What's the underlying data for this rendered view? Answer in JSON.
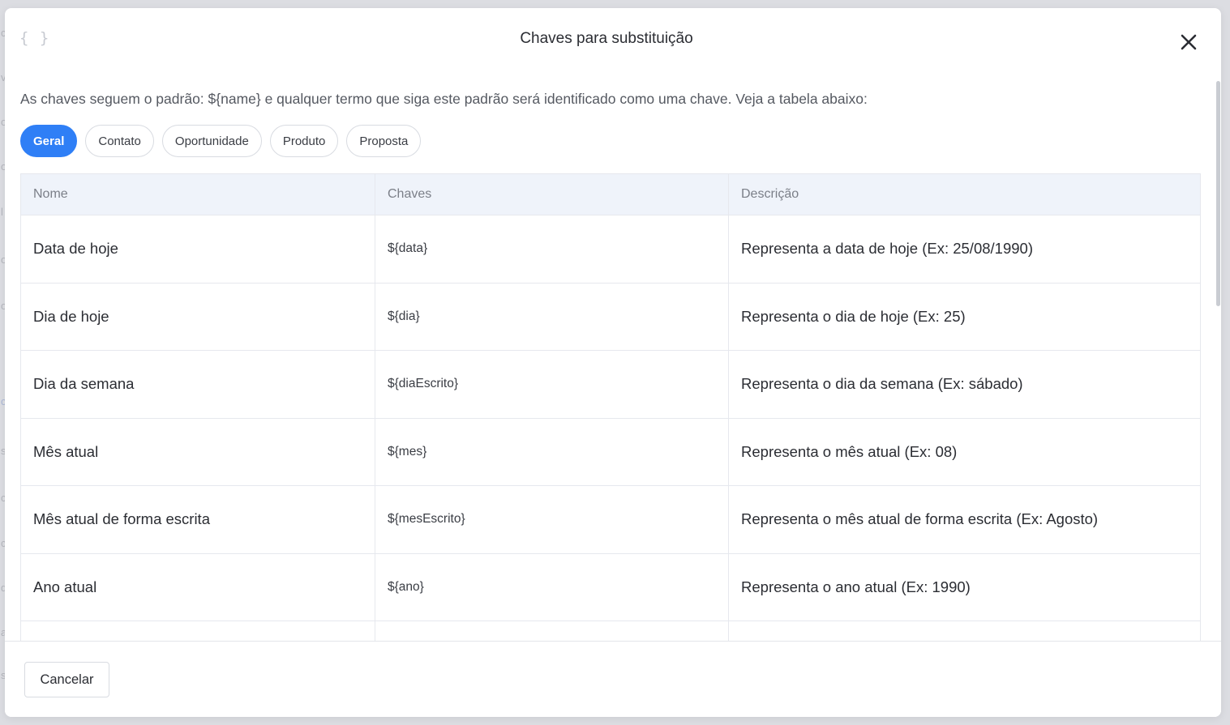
{
  "modal": {
    "title": "Chaves para substituição",
    "header_icon": "braces-icon",
    "close_icon": "close-icon"
  },
  "intro": "As chaves seguem o padrão: ${name} e qualquer termo que siga este padrão será identificado como uma chave. Veja a tabela abaixo:",
  "tabs": [
    {
      "label": "Geral",
      "active": true
    },
    {
      "label": "Contato",
      "active": false
    },
    {
      "label": "Oportunidade",
      "active": false
    },
    {
      "label": "Produto",
      "active": false
    },
    {
      "label": "Proposta",
      "active": false
    }
  ],
  "table": {
    "headers": [
      "Nome",
      "Chaves",
      "Descrição"
    ],
    "rows": [
      {
        "name": "Data de hoje",
        "key": "${data}",
        "description": "Representa a data de hoje (Ex: 25/08/1990)"
      },
      {
        "name": "Dia de hoje",
        "key": "${dia}",
        "description": "Representa o dia de hoje (Ex: 25)"
      },
      {
        "name": "Dia da semana",
        "key": "${diaEscrito}",
        "description": "Representa o dia da semana (Ex: sábado)"
      },
      {
        "name": "Mês atual",
        "key": "${mes}",
        "description": "Representa o mês atual (Ex: 08)"
      },
      {
        "name": "Mês atual de forma escrita",
        "key": "${mesEscrito}",
        "description": "Representa o mês atual de forma escrita (Ex: Agosto)"
      },
      {
        "name": "Ano atual",
        "key": "${ano}",
        "description": "Representa o ano atual (Ex: 1990)"
      }
    ]
  },
  "footer": {
    "cancel_label": "Cancelar"
  },
  "colors": {
    "accent": "#2f7ff6",
    "header_bg": "#eff3fa"
  }
}
